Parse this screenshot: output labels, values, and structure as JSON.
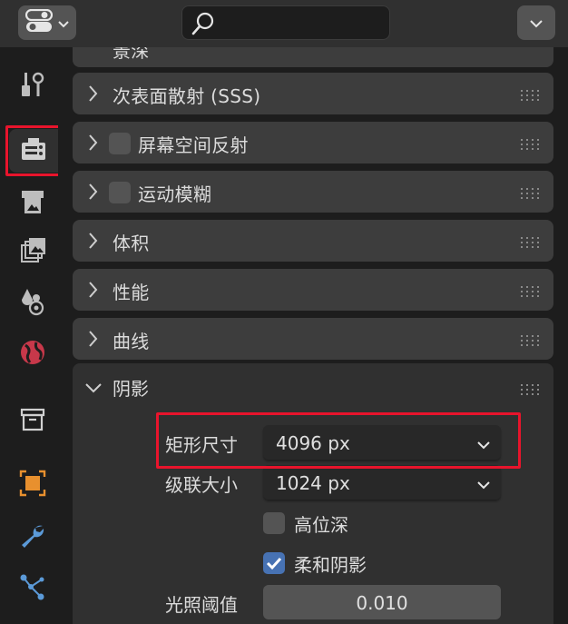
{
  "header": {
    "editor_type_icon": "properties-editor-icon",
    "search": {
      "value": "",
      "placeholder": ""
    },
    "options_icon": "chevron-down-icon"
  },
  "tabs": [
    {
      "name": "tool",
      "icon": "tool-settings-icon",
      "active": false
    },
    {
      "name": "render",
      "icon": "render-camera-icon",
      "active": true,
      "highlighted": true
    },
    {
      "name": "output",
      "icon": "output-printer-icon",
      "active": false
    },
    {
      "name": "view-layer",
      "icon": "view-layer-images-icon",
      "active": false
    },
    {
      "name": "scene",
      "icon": "scene-icon",
      "active": false
    },
    {
      "name": "world",
      "icon": "world-globe-icon",
      "active": false
    },
    {
      "name": "collection",
      "icon": "collection-box-icon",
      "active": false
    },
    {
      "name": "object",
      "icon": "object-square-icon",
      "active": false
    },
    {
      "name": "modifiers",
      "icon": "wrench-icon",
      "active": false
    },
    {
      "name": "particles",
      "icon": "particles-icon",
      "active": false
    }
  ],
  "panels": {
    "cut_off_title": "景深",
    "sss": "次表面散射 (SSS)",
    "ssr": "屏幕空间反射",
    "motion_blur": "运动模糊",
    "volumetrics": "体积",
    "performance": "性能",
    "curves": "曲线",
    "shadows": "阴影"
  },
  "shadows": {
    "cube_size_label": "矩形尺寸",
    "cube_size_value": "4096 px",
    "cascade_size_label": "级联大小",
    "cascade_size_value": "1024 px",
    "high_bitdepth_label": "高位深",
    "high_bitdepth_checked": false,
    "soft_shadows_label": "柔和阴影",
    "soft_shadows_checked": true,
    "light_threshold_label": "光照阈值",
    "light_threshold_value": "0.010"
  },
  "colors": {
    "highlight": "#e8142c",
    "accent": "#4772b3",
    "panel": "#3d3d3d",
    "background": "#1d1d1d"
  }
}
